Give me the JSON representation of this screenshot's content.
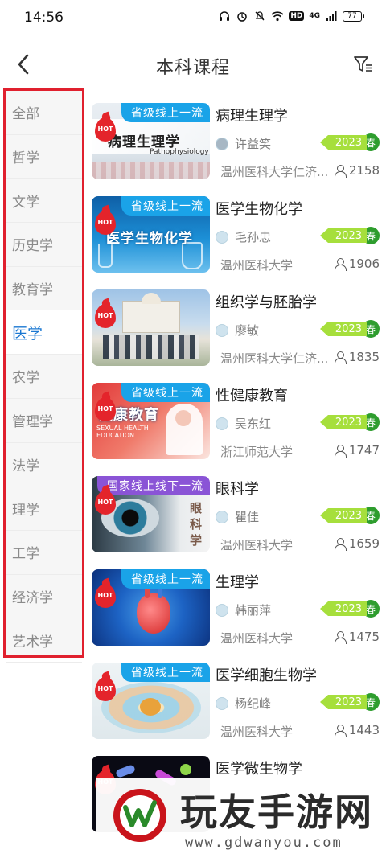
{
  "status_bar": {
    "time": "14:56",
    "network": "4G",
    "hd": "HD",
    "battery": "77",
    "icons": [
      "headphones-icon",
      "alarm-icon",
      "mute-icon",
      "wifi-icon",
      "signal-icon"
    ]
  },
  "header": {
    "title": "本科课程",
    "back_icon": "back-arrow-icon",
    "filter_icon": "filter-icon"
  },
  "sidebar": {
    "items": [
      {
        "label": "全部",
        "active": false
      },
      {
        "label": "哲学",
        "active": false
      },
      {
        "label": "文学",
        "active": false
      },
      {
        "label": "历史学",
        "active": false
      },
      {
        "label": "教育学",
        "active": false
      },
      {
        "label": "医学",
        "active": true
      },
      {
        "label": "农学",
        "active": false
      },
      {
        "label": "管理学",
        "active": false
      },
      {
        "label": "法学",
        "active": false
      },
      {
        "label": "理学",
        "active": false
      },
      {
        "label": "工学",
        "active": false
      },
      {
        "label": "经济学",
        "active": false
      },
      {
        "label": "艺术学",
        "active": false
      }
    ]
  },
  "colors": {
    "active_category": "#1977d2",
    "highlight_border": "#e0202e",
    "provincial_tag": "#1aa3e8",
    "national_tag": "#8a54d6",
    "year_badge": "#a6df3c",
    "season_badge": "#2e9d2e",
    "hot_badge": "#e4242b"
  },
  "hot_label": "HOT",
  "courses": [
    {
      "title": "病理生理学",
      "tag": "省级线上一流",
      "tag_type": "province",
      "thumb_caption": "病理生理学",
      "thumb_sub": "Pathophysiology",
      "teacher": "许益笑",
      "year": "2023",
      "season": "春",
      "school": "温州医科大学仁济...",
      "enrolled": "2158"
    },
    {
      "title": "医学生物化学",
      "tag": "省级线上一流",
      "tag_type": "province",
      "thumb_caption": "医学生物化学",
      "thumb_sub": "",
      "teacher": "毛孙忠",
      "year": "2023",
      "season": "春",
      "school": "温州医科大学",
      "enrolled": "1906"
    },
    {
      "title": "组织学与胚胎学",
      "tag": "",
      "tag_type": "none",
      "thumb_caption": "",
      "thumb_sub": "",
      "teacher": "廖敏",
      "year": "2023",
      "season": "春",
      "school": "温州医科大学仁济...",
      "enrolled": "1835"
    },
    {
      "title": "性健康教育",
      "tag": "省级线上一流",
      "tag_type": "province",
      "thumb_caption": "健康教育",
      "thumb_sub": "SEXUAL HEALTH EDUCATION",
      "teacher": "吴东红",
      "year": "2023",
      "season": "春",
      "school": "浙江师范大学",
      "enrolled": "1747"
    },
    {
      "title": "眼科学",
      "tag": "国家线上线下一流",
      "tag_type": "national",
      "thumb_caption": "眼科学",
      "thumb_sub": "",
      "teacher": "瞿佳",
      "year": "2023",
      "season": "春",
      "school": "温州医科大学",
      "enrolled": "1659"
    },
    {
      "title": "生理学",
      "tag": "省级线上一流",
      "tag_type": "province",
      "thumb_caption": "",
      "thumb_sub": "",
      "teacher": "韩丽萍",
      "year": "2023",
      "season": "春",
      "school": "温州医科大学",
      "enrolled": "1475"
    },
    {
      "title": "医学细胞生物学",
      "tag": "省级线上一流",
      "tag_type": "province",
      "thumb_caption": "",
      "thumb_sub": "",
      "teacher": "杨纪峰",
      "year": "2023",
      "season": "春",
      "school": "温州医科大学",
      "enrolled": "1443"
    },
    {
      "title": "医学微生物学",
      "tag": "",
      "tag_type": "none",
      "thumb_caption": "",
      "thumb_sub": "",
      "teacher": "",
      "year": "",
      "season": "",
      "school": "",
      "enrolled": ""
    }
  ],
  "watermark": {
    "text": "玩友手游网",
    "url": "www.gdwanyou.com"
  }
}
